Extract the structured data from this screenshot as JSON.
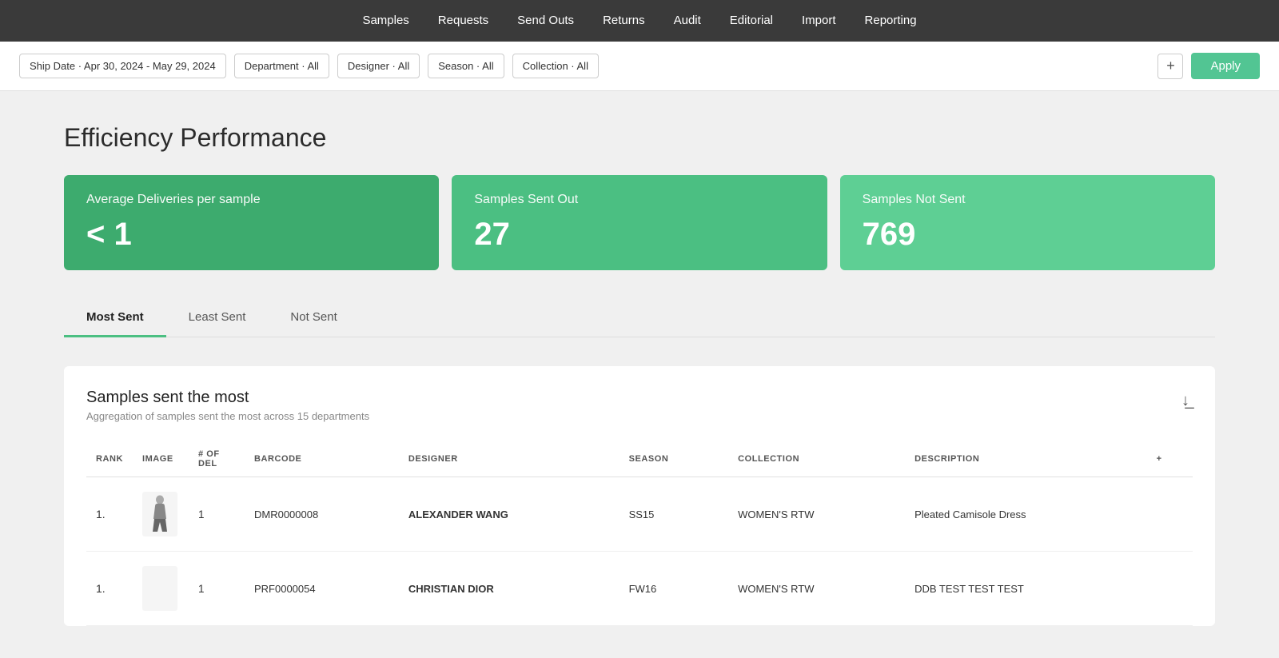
{
  "nav": {
    "items": [
      {
        "label": "Samples",
        "id": "samples"
      },
      {
        "label": "Requests",
        "id": "requests"
      },
      {
        "label": "Send Outs",
        "id": "send-outs"
      },
      {
        "label": "Returns",
        "id": "returns"
      },
      {
        "label": "Audit",
        "id": "audit"
      },
      {
        "label": "Editorial",
        "id": "editorial"
      },
      {
        "label": "Import",
        "id": "import"
      },
      {
        "label": "Reporting",
        "id": "reporting"
      }
    ]
  },
  "filters": {
    "ship_date": "Ship Date · Apr 30, 2024 - May 29, 2024",
    "department": "Department · All",
    "designer": "Designer · All",
    "season": "Season · All",
    "collection": "Collection · All",
    "add_label": "+",
    "apply_label": "Apply"
  },
  "page": {
    "title": "Efficiency Performance"
  },
  "stats": [
    {
      "label": "Average Deliveries per sample",
      "value": "< 1",
      "theme": "dark-green"
    },
    {
      "label": "Samples Sent Out",
      "value": "27",
      "theme": "mid-green"
    },
    {
      "label": "Samples Not Sent",
      "value": "769",
      "theme": "light-green"
    }
  ],
  "tabs": [
    {
      "label": "Most Sent",
      "id": "most-sent",
      "active": true
    },
    {
      "label": "Least Sent",
      "id": "least-sent",
      "active": false
    },
    {
      "label": "Not Sent",
      "id": "not-sent",
      "active": false
    }
  ],
  "table": {
    "title": "Samples sent the most",
    "subtitle": "Aggregation of samples sent the most across 15 departments",
    "columns": [
      {
        "id": "rank",
        "label": "RANK"
      },
      {
        "id": "image",
        "label": "IMAGE"
      },
      {
        "id": "num_del",
        "label": "# OF DEL"
      },
      {
        "id": "barcode",
        "label": "BARCODE"
      },
      {
        "id": "designer",
        "label": "DESIGNER"
      },
      {
        "id": "season",
        "label": "SEASON"
      },
      {
        "id": "collection",
        "label": "COLLECTION"
      },
      {
        "id": "description",
        "label": "DESCRIPTION"
      }
    ],
    "rows": [
      {
        "rank": "1.",
        "has_image": true,
        "num_del": "1",
        "barcode": "DMR0000008",
        "designer": "ALEXANDER WANG",
        "season": "SS15",
        "collection": "WOMEN'S RTW",
        "description": "Pleated Camisole Dress"
      },
      {
        "rank": "1.",
        "has_image": false,
        "num_del": "1",
        "barcode": "PRF0000054",
        "designer": "CHRISTIAN DIOR",
        "season": "FW16",
        "collection": "WOMEN'S RTW",
        "description": "DDB TEST TEST TEST"
      }
    ]
  }
}
